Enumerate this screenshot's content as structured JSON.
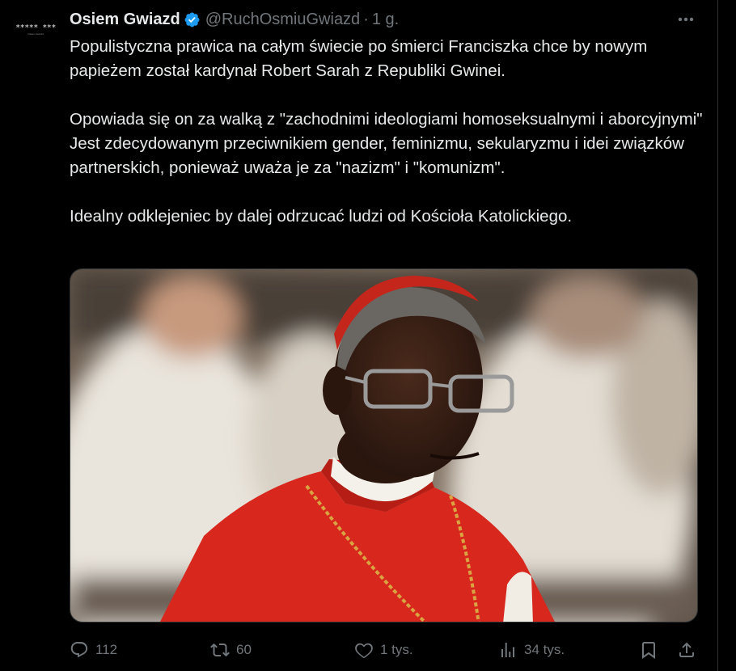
{
  "avatar": {
    "stars": "***** ***",
    "subtitle": "Osiem Gwiazd"
  },
  "post": {
    "author_name": "Osiem Gwiazd",
    "handle": "@RuchOsmiuGwiazd",
    "separator": "·",
    "time": "1 g.",
    "paragraphs": [
      "Populistyczna prawica na całym świecie po śmierci Franciszka chce by nowym papieżem został kardynał Robert Sarah z Republiki Gwinei.",
      "Opowiada się on za walką z \"zachodnimi ideologiami homoseksualnymi i aborcyjnymi\" Jest zdecydowanym przeciwnikiem gender, feminizmu, sekularyzmu i idei związków partnerskich, ponieważ uważa je za \"nazizm\" i \"komunizm\".",
      "Idealny odklejeniec by dalej odrzucać ludzi od Kościoła Katolickiego."
    ]
  },
  "actions": {
    "replies": "112",
    "retweets": "60",
    "likes": "1 tys.",
    "views": "34 tys."
  },
  "colors": {
    "background": "#000000",
    "text": "#e7e9ea",
    "muted": "#71767b",
    "verified": "#1d9bf0"
  }
}
